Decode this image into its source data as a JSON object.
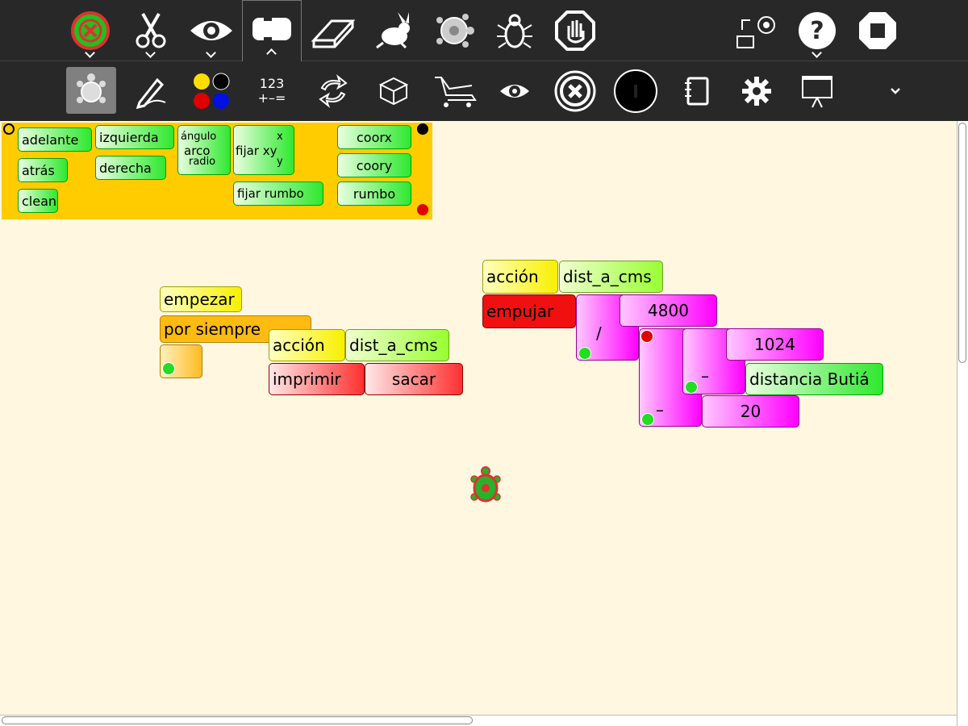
{
  "colors": {
    "toolbar_bg": "#282828",
    "canvas_bg": "#fff7e0",
    "palette_bg": "#ffcc00",
    "turtle_block": "#00ff00",
    "flow_block": "#ffbb11",
    "action_block": "#ffff00",
    "store_block": "#ff0000",
    "number_block": "#ff00ff"
  },
  "toolbar_top": {
    "icons": [
      "stop-turtle-icon",
      "scissors-icon",
      "eye-icon",
      "palette-toggle-icon",
      "eraser-icon",
      "rabbit-icon",
      "turtle-icon",
      "bug-icon",
      "stop-hand-icon",
      "share-icon",
      "help-icon",
      "stop-icon"
    ]
  },
  "toolbar_bottom": {
    "numbers_label": "123",
    "operators_label": "+–="
  },
  "palette": {
    "forward": "adelante",
    "back": "atrás",
    "clean": "clean",
    "left": "izquierda",
    "right": "derecha",
    "arc": "arco",
    "arc_angle": "ángulo",
    "arc_radius": "radio",
    "setxy": "fijar xy",
    "setxy_x": "x",
    "setxy_y": "y",
    "setheading": "fijar rumbo",
    "xcor": "coorx",
    "ycor": "coory",
    "heading": "rumbo"
  },
  "canvas": {
    "start": "empezar",
    "forever": "por siempre",
    "action1": "acción",
    "action1_name": "dist_a_cms",
    "print": "imprimir",
    "print_arg": "sacar",
    "action2": "acción",
    "action2_name": "dist_a_cms",
    "push": "empujar",
    "n4800": "4800",
    "div": "/",
    "n1024": "1024",
    "minus1": "–",
    "distance": "distancia Butiá",
    "minus2": "–",
    "n20": "20"
  }
}
